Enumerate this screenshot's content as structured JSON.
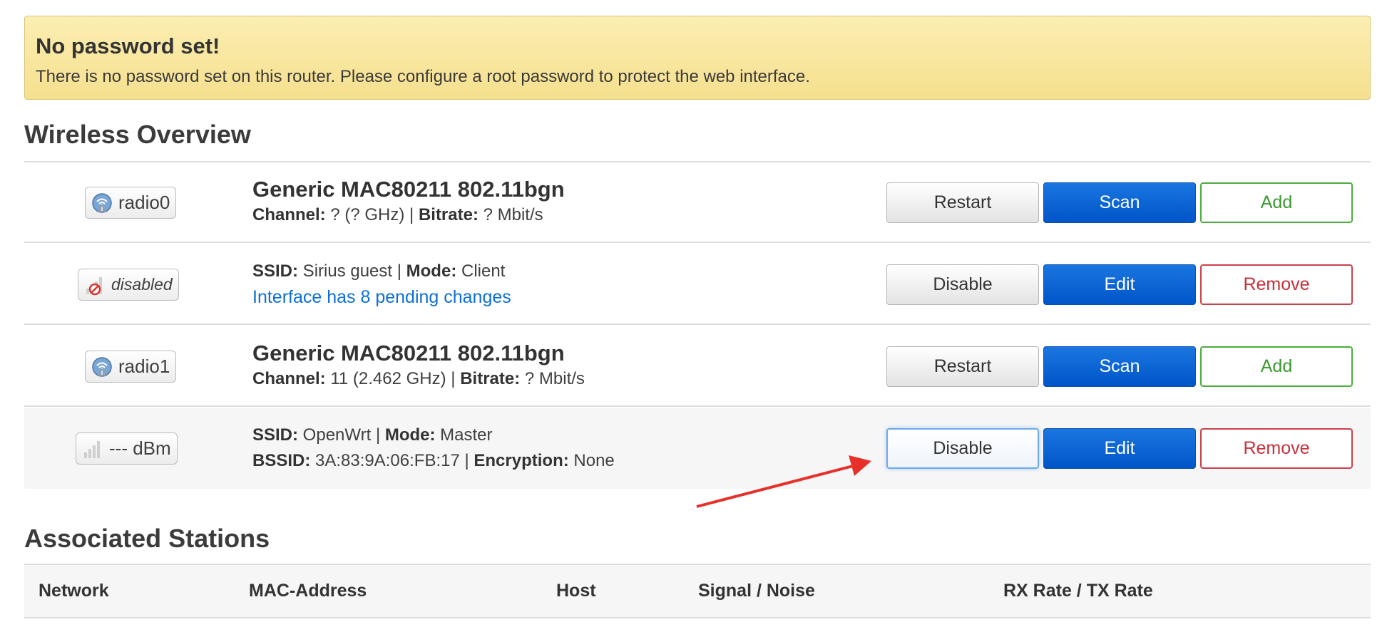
{
  "alert": {
    "title": "No password set!",
    "message": "There is no password set on this router. Please configure a root password to protect the web interface."
  },
  "wireless": {
    "heading": "Wireless Overview",
    "rows": [
      {
        "badge": "radio0",
        "icon": "wifi-radio-icon",
        "title": "Generic MAC80211 802.11bgn",
        "line1": [
          {
            "k": "Channel:",
            "v": " ? (? GHz) | "
          },
          {
            "k": "Bitrate:",
            "v": " ? Mbit/s"
          }
        ],
        "buttons": [
          "Restart",
          "Scan",
          "Add"
        ]
      },
      {
        "badge": "disabled",
        "icon": "signal-disabled-icon",
        "line1": [
          {
            "k": "SSID:",
            "v": " Sirius guest | "
          },
          {
            "k": "Mode:",
            "v": " Client"
          }
        ],
        "link": "Interface has 8 pending changes",
        "buttons": [
          "Disable",
          "Edit",
          "Remove"
        ]
      },
      {
        "badge": "radio1",
        "icon": "wifi-radio-icon",
        "title": "Generic MAC80211 802.11bgn",
        "line1": [
          {
            "k": "Channel:",
            "v": " 11 (2.462 GHz) | "
          },
          {
            "k": "Bitrate:",
            "v": " ? Mbit/s"
          }
        ],
        "buttons": [
          "Restart",
          "Scan",
          "Add"
        ]
      },
      {
        "badge": "--- dBm",
        "icon": "signal-bars-icon",
        "line1": [
          {
            "k": "SSID:",
            "v": " OpenWrt | "
          },
          {
            "k": "Mode:",
            "v": " Master"
          }
        ],
        "line2": [
          {
            "k": "BSSID:",
            "v": " 3A:83:9A:06:FB:17 | "
          },
          {
            "k": "Encryption:",
            "v": " None"
          }
        ],
        "buttons": [
          "Disable",
          "Edit",
          "Remove"
        ]
      }
    ]
  },
  "stations": {
    "heading": "Associated Stations",
    "columns": [
      "Network",
      "MAC-Address",
      "Host",
      "Signal / Noise",
      "RX Rate / TX Rate"
    ]
  },
  "colors": {
    "alert_bg": "#f5e08e",
    "primary": "#0055c8",
    "positive": "#4aad3d",
    "negative": "#c8414b",
    "link": "#0d6fd6",
    "annotation_arrow": "#e8302a"
  }
}
